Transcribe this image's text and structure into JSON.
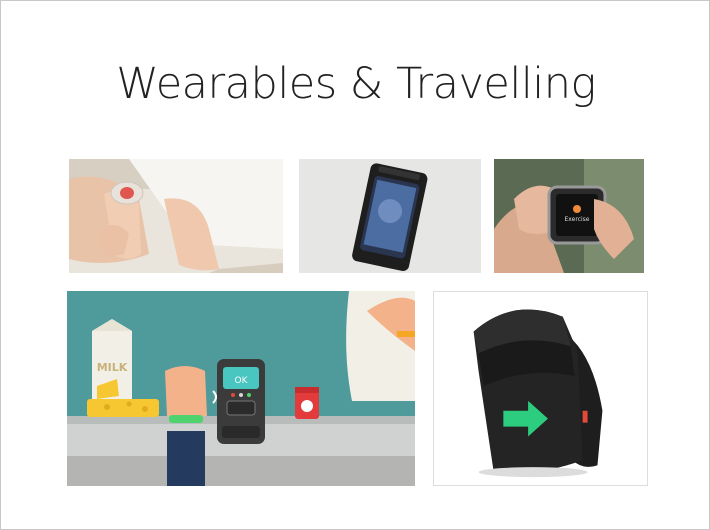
{
  "slide": {
    "title": "Wearables & Travelling"
  },
  "illustration": {
    "milk_label": "MILK",
    "terminal_screen_text": "OK"
  },
  "photos": [
    {
      "subject": "baby-foot-sensor-band"
    },
    {
      "subject": "waterproof-phone-pouch"
    },
    {
      "subject": "smartwatch-on-hand"
    },
    {
      "subject": "contactless-payment-illustration"
    },
    {
      "subject": "backpack-with-turn-signal-arrow"
    }
  ],
  "colors": {
    "illustration_wall": "#4f9a9b",
    "terminal_screen": "#49c6c0",
    "arrow_green": "#2ee08a",
    "milk_carton": "#f2f0e6",
    "cheese_yellow": "#f7c731"
  }
}
